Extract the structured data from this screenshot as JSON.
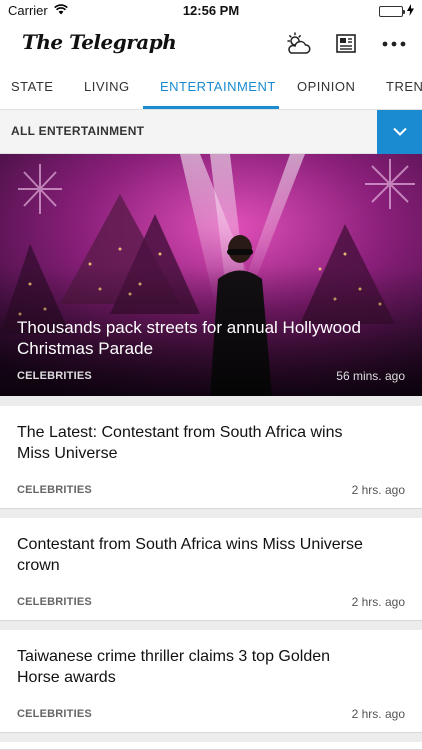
{
  "status": {
    "carrier": "Carrier",
    "time": "12:56 PM"
  },
  "header": {
    "logo": "The Telegraph",
    "icons": [
      "weather-icon",
      "newspaper-icon",
      "more-icon"
    ]
  },
  "tabs": [
    {
      "label": "STATE"
    },
    {
      "label": "LIVING"
    },
    {
      "label": "ENTERTAINMENT",
      "active": true
    },
    {
      "label": "OPINION"
    },
    {
      "label": "TREND"
    }
  ],
  "section": {
    "title": "ALL ENTERTAINMENT"
  },
  "hero": {
    "title": "Thousands pack streets for annual Hollywood Christmas Parade",
    "category": "CELEBRITIES",
    "time": "56 mins. ago"
  },
  "articles": [
    {
      "title": "The Latest: Contestant from South Africa wins Miss Universe",
      "category": "CELEBRITIES",
      "time": "2 hrs. ago"
    },
    {
      "title": "Contestant from South Africa wins Miss Universe crown",
      "category": "CELEBRITIES",
      "time": "2 hrs. ago"
    },
    {
      "title": "Taiwanese crime thriller claims 3 top Golden Horse awards",
      "category": "CELEBRITIES",
      "time": "2 hrs. ago"
    }
  ],
  "colors": {
    "accent": "#1a8bd1",
    "battery": "#2fc449"
  }
}
